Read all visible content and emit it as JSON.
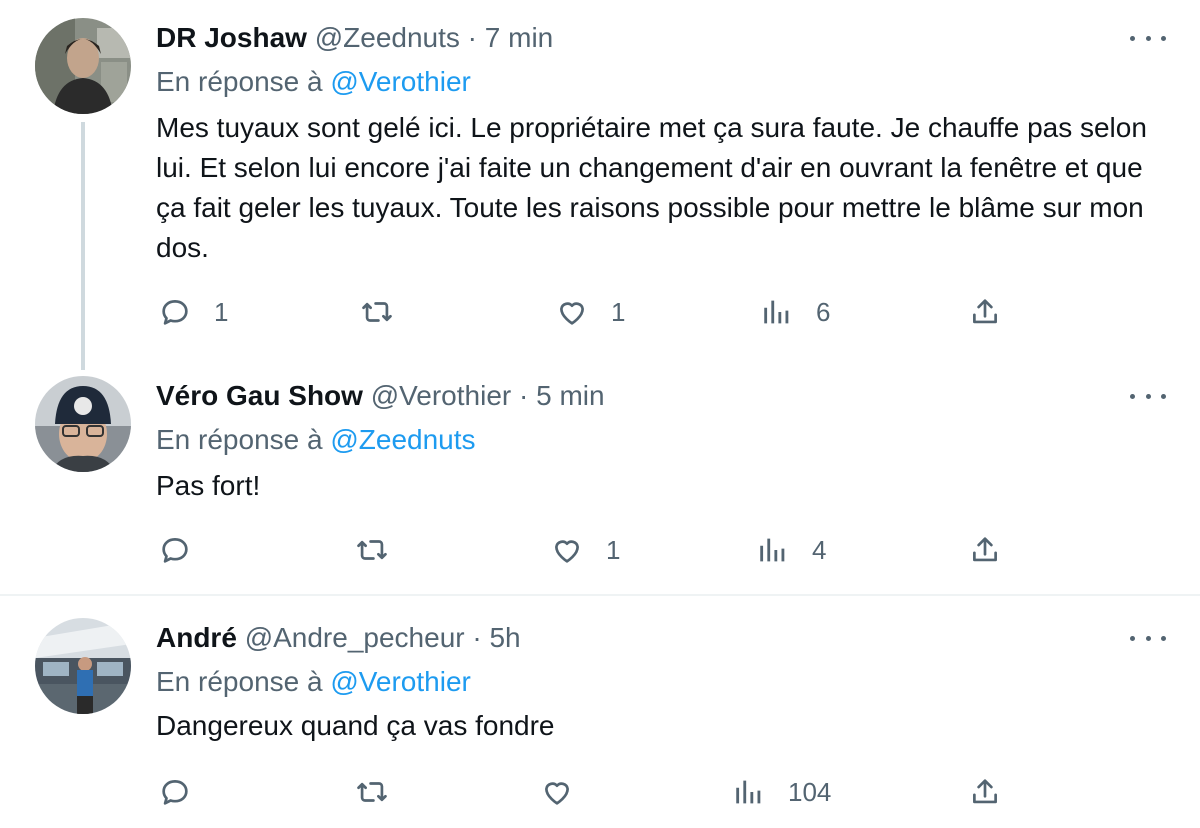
{
  "tweets": [
    {
      "name": "DR Joshaw",
      "handle": "@Zeednuts",
      "separator": "·",
      "time": "7 min",
      "reply_prefix": "En réponse à",
      "reply_to": "@Verothier",
      "text": "Mes tuyaux sont gelé ici. Le propriétaire met ça sura faute. Je chauffe pas selon lui. Et selon lui encore j'ai faite un changement d'air en ouvrant la fenêtre et que ça fait geler les tuyaux. Toute les raisons possible pour mettre le blâme sur mon dos.",
      "replies": "1",
      "retweets": "",
      "likes": "1",
      "views": "6"
    },
    {
      "name": "Véro Gau Show",
      "handle": "@Verothier",
      "separator": "·",
      "time": "5 min",
      "reply_prefix": "En réponse à",
      "reply_to": "@Zeednuts",
      "text": "Pas fort!",
      "replies": "",
      "retweets": "",
      "likes": "1",
      "views": "4"
    },
    {
      "name": "André",
      "handle": "@Andre_pecheur",
      "separator": "·",
      "time": "5h",
      "reply_prefix": "En réponse à",
      "reply_to": "@Verothier",
      "text": "Dangereux quand ça vas fondre",
      "replies": "",
      "retweets": "",
      "likes": "",
      "views": "104"
    }
  ],
  "icons": {
    "reply": "reply-icon",
    "retweet": "retweet-icon",
    "like": "heart-icon",
    "views": "views-icon",
    "share": "share-icon",
    "more": "more-icon"
  },
  "colors": {
    "text": "#0f1419",
    "secondary": "#536471",
    "link": "#1d9bf0",
    "thread_line": "#cfd9de",
    "divider": "#eff3f4"
  }
}
